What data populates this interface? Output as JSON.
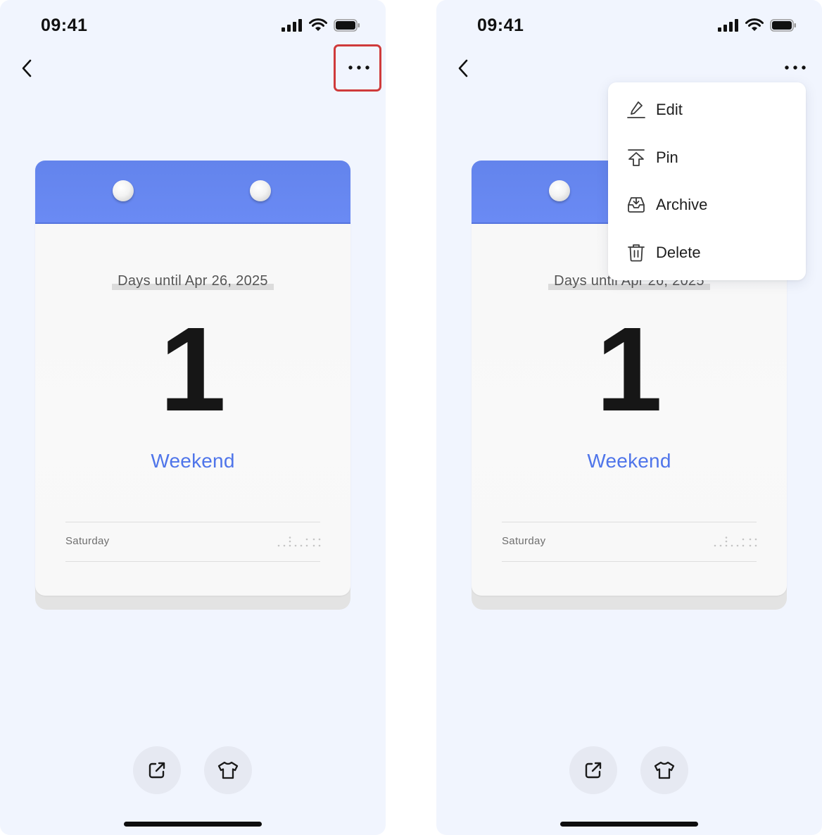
{
  "status_bar": {
    "time": "09:41"
  },
  "card": {
    "target_label": "Days until Apr 26, 2025",
    "days": "1",
    "event_name": "Weekend",
    "weekday": "Saturday"
  },
  "menu": {
    "items": [
      {
        "label": "Edit",
        "icon": "pencil-icon"
      },
      {
        "label": "Pin",
        "icon": "pin-top-icon"
      },
      {
        "label": "Archive",
        "icon": "archive-icon"
      },
      {
        "label": "Delete",
        "icon": "trash-icon"
      }
    ]
  },
  "colors": {
    "background": "#f1f5fe",
    "header_blue": "#6787f0",
    "accent_text": "#4f75ea",
    "highlight_red": "#cf3b3b"
  }
}
